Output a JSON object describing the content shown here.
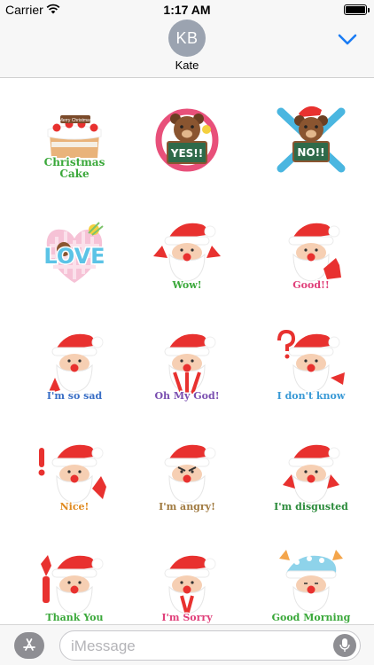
{
  "status_bar": {
    "carrier": "Carrier",
    "time": "1:17 AM",
    "battery_level": 1.0
  },
  "header": {
    "avatar_initials": "KB",
    "contact_name": "Kate",
    "chevron_icon": "chevron-down-icon",
    "accent_color": "#1a7cf4"
  },
  "stickers": [
    {
      "label_lines": [
        "Christmas",
        "Cake"
      ],
      "banner": "Merry Christmas",
      "label_color": "#3aa83a",
      "art": "cake"
    },
    {
      "label_lines": [],
      "board_text": "YES!!",
      "label_color": "#ffffff",
      "art": "bear-yes"
    },
    {
      "label_lines": [],
      "board_text": "NO!!",
      "label_color": "#ffffff",
      "art": "bear-no"
    },
    {
      "label_lines": [
        "LOVE"
      ],
      "label_color": "#5bc3e6",
      "art": "love-heart"
    },
    {
      "label_lines": [
        "Wow!"
      ],
      "label_color": "#3aa83a",
      "art": "santa-hands-up"
    },
    {
      "label_lines": [
        "Good!!"
      ],
      "label_color": "#e0407a",
      "art": "santa-thumbs"
    },
    {
      "label_lines": [
        "I'm so sad"
      ],
      "label_color": "#3a6fc6",
      "art": "santa-sad"
    },
    {
      "label_lines": [
        "Oh My God!"
      ],
      "label_color": "#7a4fb0",
      "art": "santa-omg"
    },
    {
      "label_lines": [
        "I don't know"
      ],
      "label_color": "#3a9ad6",
      "art": "santa-question"
    },
    {
      "label_lines": [
        "Nice!"
      ],
      "label_color": "#e08a20",
      "art": "santa-nice"
    },
    {
      "label_lines": [
        "I'm angry!"
      ],
      "label_color": "#a07a40",
      "art": "santa-angry"
    },
    {
      "label_lines": [
        "I'm disgusted"
      ],
      "label_color": "#2a8a3a",
      "art": "santa-disgusted"
    },
    {
      "label_lines": [
        "Thank You"
      ],
      "label_color": "#3aa83a",
      "art": "santa-thanks"
    },
    {
      "label_lines": [
        "I'm Sorry"
      ],
      "label_color": "#e0407a",
      "art": "santa-sorry"
    },
    {
      "label_lines": [
        "Good Morning"
      ],
      "label_color": "#3aa83a",
      "art": "santa-morning"
    }
  ],
  "compose": {
    "placeholder": "iMessage",
    "value": "",
    "appstore_icon": "app-store-icon",
    "mic_icon": "microphone-icon"
  }
}
